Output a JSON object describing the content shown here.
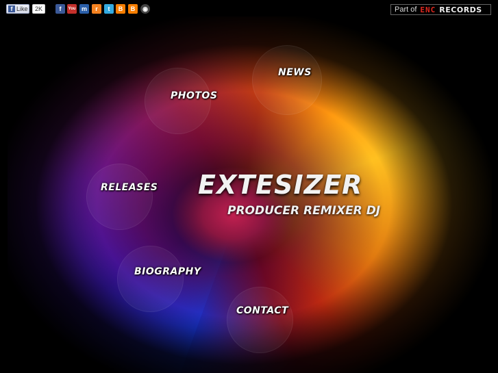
{
  "facebook_like": {
    "label": "Like",
    "count": "2K"
  },
  "social_icons": [
    {
      "name": "facebook-icon",
      "glyph": "f",
      "color": "#3b5998"
    },
    {
      "name": "youtube-icon",
      "glyph": "You",
      "color": "#c4302b"
    },
    {
      "name": "myspace-icon",
      "glyph": "m",
      "color": "#2a5ea8"
    },
    {
      "name": "rss-icon",
      "glyph": "r",
      "color": "#f58220"
    },
    {
      "name": "twitter-icon",
      "glyph": "t",
      "color": "#33aae0"
    },
    {
      "name": "blogger-icon",
      "glyph": "B",
      "color": "#f57d00"
    },
    {
      "name": "blogger-alt-icon",
      "glyph": "B",
      "color": "#f57d00"
    },
    {
      "name": "disc-icon",
      "glyph": "◉",
      "color": "#444"
    }
  ],
  "network": {
    "part_of": "Part of",
    "brand_enc": "ENC",
    "brand_records": "RECORDS"
  },
  "nav": {
    "news": "NEWS",
    "photos": "PHOTOS",
    "releases": "RELEASES",
    "biography": "BIOGRAPHY",
    "contact": "CONTACT"
  },
  "logo": {
    "title": "EXTESIZER",
    "subtitle": "PRODUCER REMIXER DJ"
  },
  "colors": {
    "enc_red": "#e0281f",
    "background": "#000000"
  }
}
